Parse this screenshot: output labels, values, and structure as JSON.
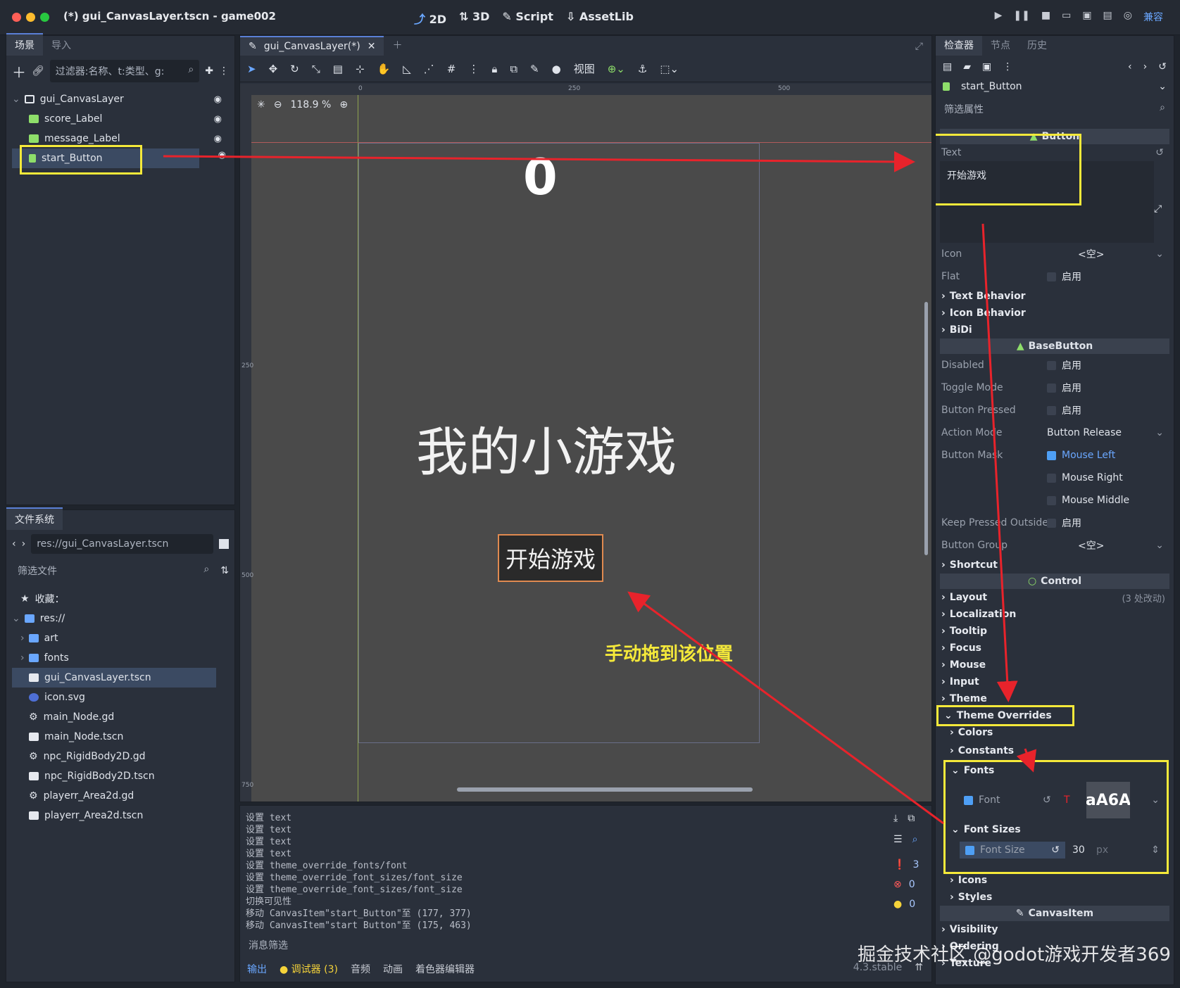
{
  "window": {
    "title": "(*) gui_CanvasLayer.tscn - game002"
  },
  "topnav": {
    "btn_2d": "2D",
    "btn_3d": "3D",
    "btn_script": "Script",
    "btn_assetlib": "AssetLib",
    "compat": "兼容"
  },
  "scene": {
    "tab_scene": "场景",
    "tab_import": "导入",
    "filter_placeholder": "过滤器:名称、t:类型、g:",
    "nodes": [
      {
        "label": "gui_CanvasLayer"
      },
      {
        "label": "score_Label"
      },
      {
        "label": "message_Label"
      },
      {
        "label": "start_Button"
      }
    ]
  },
  "filesystem": {
    "tab": "文件系统",
    "path": "res://gui_CanvasLayer.tscn",
    "filter_placeholder": "筛选文件",
    "favorites": "收藏：",
    "root": "res://",
    "items": [
      {
        "label": "art"
      },
      {
        "label": "fonts"
      },
      {
        "label": "gui_CanvasLayer.tscn"
      },
      {
        "label": "icon.svg"
      },
      {
        "label": "main_Node.gd"
      },
      {
        "label": "main_Node.tscn"
      },
      {
        "label": "npc_RigidBody2D.gd"
      },
      {
        "label": "npc_RigidBody2D.tscn"
      },
      {
        "label": "playerr_Area2d.gd"
      },
      {
        "label": "playerr_Area2d.tscn"
      }
    ]
  },
  "editor": {
    "tab": "gui_CanvasLayer(*)",
    "view_menu": "视图",
    "zoom": "118.9 %",
    "ruler": {
      "r0": "0",
      "r250": "250",
      "r500": "500",
      "v250": "250",
      "v500": "500",
      "v750": "750"
    },
    "score_text": "0",
    "title_text": "我的小游戏",
    "button_text": "开始游戏",
    "annotation": "手动拖到该位置"
  },
  "output": {
    "lines": [
      "设置 text",
      "设置 text",
      "设置 text",
      "设置 text",
      "设置 theme_override_fonts/font",
      "设置 theme_override_font_sizes/font_size",
      "设置 theme_override_font_sizes/font_size",
      "切换可见性",
      "移动 CanvasItem\"start_Button\"至 (177, 377)",
      "移动 CanvasItem\"start_Button\"至 (175, 463)"
    ],
    "filter_placeholder": "消息筛选",
    "count_messages": "3",
    "count_errors": "0",
    "count_warnings": "0",
    "tabs": {
      "output": "输出",
      "debugger": "调试器 (3)",
      "audio": "音频",
      "animation": "动画",
      "shader": "着色器编辑器"
    },
    "version": "4.3.stable"
  },
  "inspector": {
    "tab_inspector": "检查器",
    "tab_node": "节点",
    "tab_history": "历史",
    "node_name": "start_Button",
    "filter_placeholder": "筛选属性",
    "cat_button": "Button",
    "text_label": "Text",
    "text_value": "开始游戏",
    "icon_label": "Icon",
    "icon_value": "<空>",
    "flat_label": "Flat",
    "enable": "启用",
    "text_behavior": "Text Behavior",
    "icon_behavior": "Icon Behavior",
    "bidi": "BiDi",
    "cat_basebutton": "BaseButton",
    "disabled": "Disabled",
    "toggle_mode": "Toggle Mode",
    "button_pressed": "Button Pressed",
    "action_mode": "Action Mode",
    "action_mode_value": "Button Release",
    "button_mask": "Button Mask",
    "mouse_left": "Mouse Left",
    "mouse_right": "Mouse Right",
    "mouse_middle": "Mouse Middle",
    "keep_pressed": "Keep Pressed Outside",
    "button_group": "Button Group",
    "button_group_value": "<空>",
    "shortcut": "Shortcut",
    "cat_control": "Control",
    "layout": "Layout",
    "layout_changes": "(3 处改动)",
    "localization": "Localization",
    "tooltip": "Tooltip",
    "focus": "Focus",
    "mouse": "Mouse",
    "input": "Input",
    "theme": "Theme",
    "theme_overrides": "Theme Overrides",
    "colors": "Colors",
    "constants": "Constants",
    "fonts": "Fonts",
    "font": "Font",
    "font_preview": "aA6A",
    "font_sizes": "Font Sizes",
    "font_size": "Font Size",
    "font_size_value": "30",
    "px": "px",
    "icons": "Icons",
    "styles": "Styles",
    "cat_canvasitem": "CanvasItem",
    "visibility": "Visibility",
    "ordering": "Ordering",
    "texture": "Texture"
  },
  "watermark": "掘金技术社区 @godot游戏开发者369",
  "colors": {
    "accent": "#6aa7ff",
    "highlight": "#f5e93a",
    "arrow": "#e8232b",
    "annotation": "#f5e93a"
  }
}
